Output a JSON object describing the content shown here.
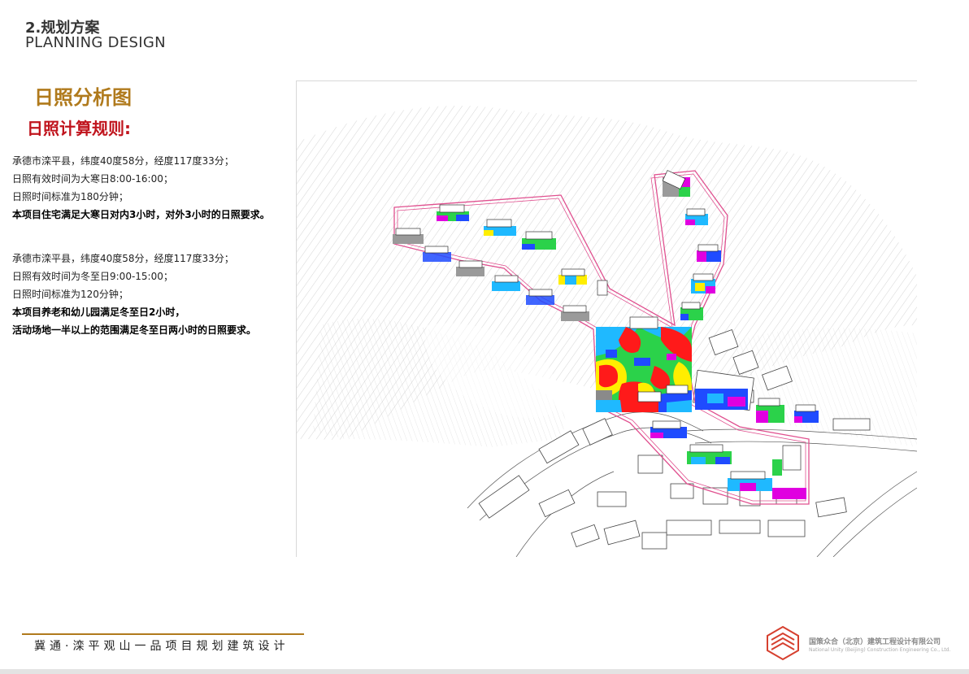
{
  "header": {
    "section_number": "2.规划方案",
    "section_en": "PLANNING DESIGN"
  },
  "figure": {
    "title": "日照分析图",
    "rules_title": "日照计算规则:"
  },
  "rules": {
    "block1": {
      "location": "承德市滦平县，纬度40度58分，经度117度33分；",
      "valid_time": "日照有效时间为大寒日8:00-16:00；",
      "standard": "日照时间标准为180分钟；",
      "requirement": "本项目住宅满足大寒日对内3小时，对外3小时的日照要求。"
    },
    "block2": {
      "location": "承德市滦平县，纬度40度58分，经度117度33分；",
      "valid_time": "日照有效时间为冬至日9:00-15:00；",
      "standard": "日照时间标准为120分钟；",
      "requirement_1": "本项目养老和幼儿园满足冬至日2小时，",
      "requirement_2": "活动场地一半以上的范围满足冬至日两小时的日照要求。"
    }
  },
  "footer": {
    "project": "冀通·滦平观山一品项目规划建筑设计"
  },
  "logo": {
    "company_cn": "国策众合（北京）建筑工程设计有限公司",
    "company_en": "National Unity (Beijing) Construction Engineering Co., Ltd."
  },
  "colors": {
    "accent_gold": "#b07a1c",
    "accent_red": "#c0141d",
    "boundary_pink": "#e0508f"
  }
}
